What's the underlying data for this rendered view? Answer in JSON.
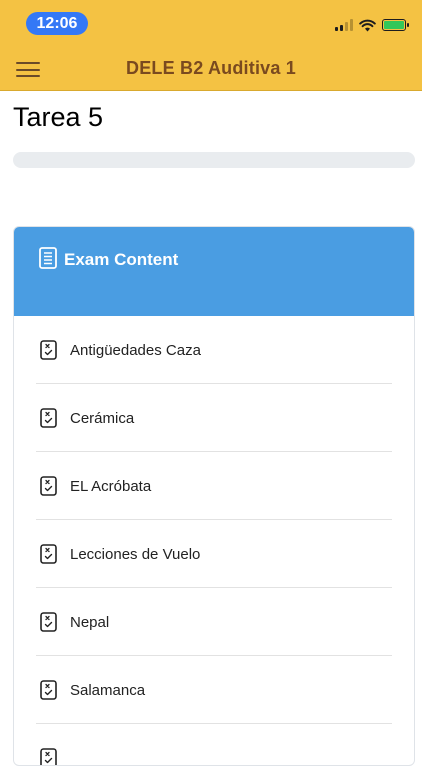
{
  "status_bar": {
    "time": "12:06",
    "battery_color": "#33c759"
  },
  "header": {
    "title": "DELE B2 Auditiva 1",
    "background": "#f4c243",
    "title_color": "#7a4a1f"
  },
  "page": {
    "title": "Tarea 5"
  },
  "progress": {
    "value_percent": 0,
    "track_color": "#e9ecef"
  },
  "exam_card": {
    "title": "Exam Content",
    "header_color": "#4a9de2",
    "items": [
      {
        "label": "Antigüedades Caza",
        "icon": "quiz-icon"
      },
      {
        "label": "Cerámica",
        "icon": "quiz-icon"
      },
      {
        "label": "EL Acróbata",
        "icon": "quiz-icon"
      },
      {
        "label": "Lecciones de Vuelo",
        "icon": "quiz-icon"
      },
      {
        "label": "Nepal",
        "icon": "quiz-icon"
      },
      {
        "label": "Salamanca",
        "icon": "quiz-icon"
      },
      {
        "label": "",
        "icon": "quiz-icon"
      }
    ]
  }
}
